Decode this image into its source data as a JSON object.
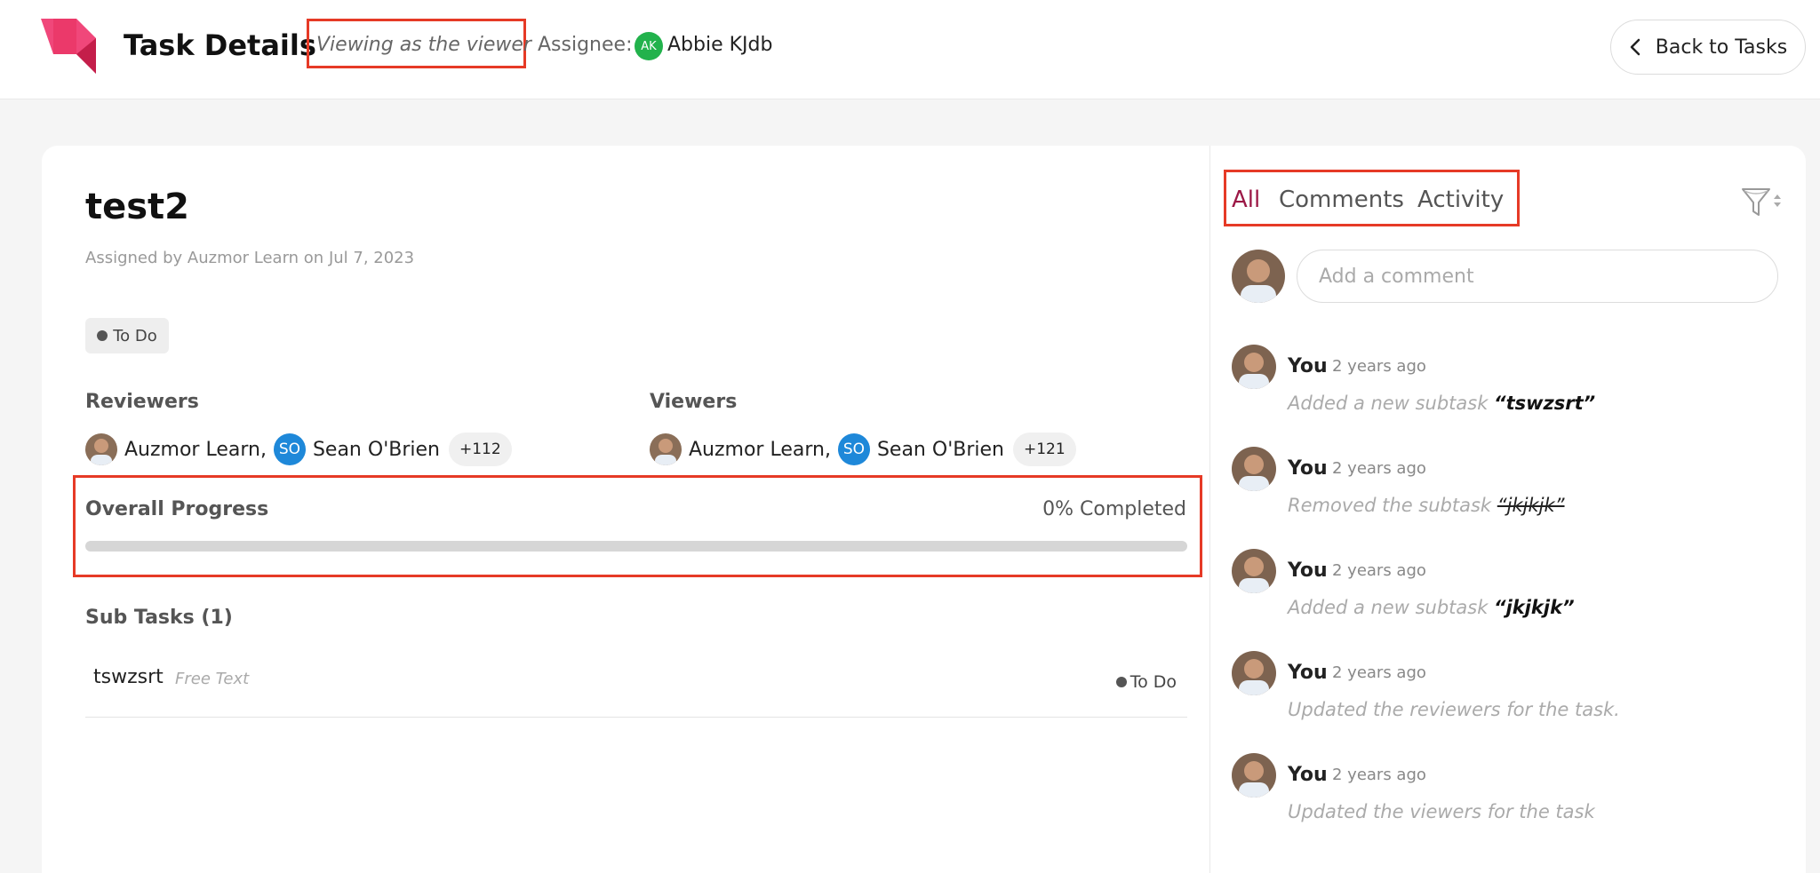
{
  "header": {
    "title": "Task Details",
    "viewer_mode": "Viewing as the viewer",
    "assignee_label": "Assignee:",
    "assignee_initials": "AK",
    "assignee_name": "Abbie KJdb",
    "back_label": "Back to Tasks"
  },
  "task": {
    "title": "test2",
    "assigned_by": "Assigned by Auzmor Learn on  Jul 7, 2023",
    "status": "To Do",
    "reviewers": {
      "label": "Reviewers",
      "first": "Auzmor Learn,",
      "second_initials": "SO",
      "second": "Sean O'Brien",
      "more": "+112"
    },
    "viewers": {
      "label": "Viewers",
      "first": "Auzmor Learn,",
      "second_initials": "SO",
      "second": "Sean O'Brien",
      "more": "+121"
    },
    "progress": {
      "label": "Overall Progress",
      "value_text": "0% Completed",
      "percent": 0
    },
    "subtasks": {
      "label": "Sub Tasks (1)",
      "items": [
        {
          "name": "tswzsrt",
          "type": "Free Text",
          "status": "To Do"
        }
      ]
    }
  },
  "activity_panel": {
    "tabs": [
      "All",
      "Comments",
      "Activity"
    ],
    "active_tab": "All",
    "comment_placeholder": "Add a comment",
    "items": [
      {
        "user": "You",
        "time": "2 years ago",
        "text": "Added a new subtask ",
        "target": "“tswzsrt”"
      },
      {
        "user": "You",
        "time": "2 years ago",
        "text": "Removed the subtask ",
        "target": "“jkjkjk”"
      },
      {
        "user": "You",
        "time": "2 years ago",
        "text": "Added a new subtask ",
        "target": "“jkjkjk”"
      },
      {
        "user": "You",
        "time": "2 years ago",
        "text": "Updated the reviewers for the task.",
        "target": ""
      },
      {
        "user": "You",
        "time": "2 years ago",
        "text": "Updated the viewers for the task",
        "target": ""
      }
    ]
  },
  "colors": {
    "accent": "#9c1846",
    "highlight_box": "#e63a26",
    "assignee_avatar": "#22b24c",
    "initials_avatar": "#1e88d9",
    "logo": "#f0477a"
  },
  "icons": {
    "logo": "brand-logo-icon",
    "back": "chevron-left-icon",
    "filter": "filter-funnel-icon",
    "status": "dot-icon"
  }
}
